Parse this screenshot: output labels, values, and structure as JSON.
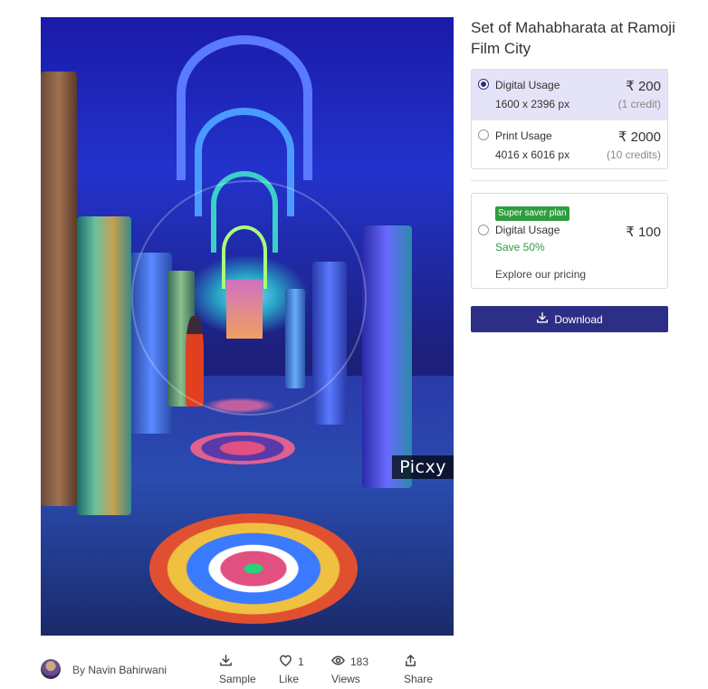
{
  "image": {
    "watermark": "Picxy"
  },
  "title": "Set of Mahabharata at Ramoji Film City",
  "licenses": [
    {
      "name": "Digital Usage",
      "size": "1600 x 2396 px",
      "price": "₹ 200",
      "credits": "(1 credit)",
      "selected": true
    },
    {
      "name": "Print Usage",
      "size": "4016 x 6016 px",
      "price": "₹ 2000",
      "credits": "(10 credits)",
      "selected": false
    }
  ],
  "saver": {
    "badge": "Super saver plan",
    "name": "Digital Usage",
    "save": "Save 50%",
    "price": "₹ 100",
    "explore": "Explore our pricing"
  },
  "download_label": "Download",
  "footer": {
    "by": "By",
    "author": "Navin Bahirwani",
    "sample_label": "Sample",
    "like_count": "1",
    "like_label": "Like",
    "views_count": "183",
    "views_label": "Views",
    "share_label": "Share"
  },
  "colors": {
    "primary": "#2d2f86",
    "selected_bg": "#e4e3f7",
    "saver_green": "#2e9e3e"
  }
}
